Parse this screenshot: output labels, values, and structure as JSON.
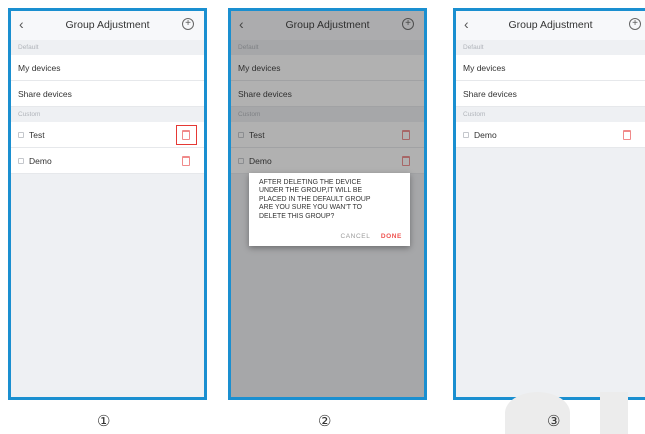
{
  "screens": [
    {
      "header": {
        "back_icon": "‹",
        "title": "Group Adjustment",
        "add_icon": "+"
      },
      "default_section": "Default",
      "default_items": [
        "My devices",
        "Share devices"
      ],
      "custom_section": "Custom",
      "custom_items": [
        "Test",
        "Demo"
      ],
      "step_label": "①"
    },
    {
      "header": {
        "back_icon": "‹",
        "title": "Group Adjustment",
        "add_icon": "+"
      },
      "default_section": "Default",
      "default_items": [
        "My devices",
        "Share devices"
      ],
      "custom_section": "Custom",
      "custom_items": [
        "Test",
        "Demo"
      ],
      "dialog": {
        "message": "AFTER DELETING THE DEVICE\nUNDER THE GROUP,IT WILL BE\nPLACED IN THE DEFAULT GROUP\n ARE YOU SURE YOU WAN'T TO\nDELETE THIS GROUP?",
        "cancel": "CANCEL",
        "done": "DONE"
      },
      "step_label": "②"
    },
    {
      "header": {
        "back_icon": "‹",
        "title": "Group Adjustment",
        "add_icon": "+"
      },
      "default_section": "Default",
      "default_items": [
        "My devices",
        "Share devices"
      ],
      "custom_section": "Custom",
      "custom_items": [
        "Demo"
      ],
      "step_label": "③"
    }
  ],
  "colors": {
    "frame": "#1a8fd0",
    "delete": "#f08a8a",
    "highlight": "#e53935",
    "done": "#ef5350"
  }
}
